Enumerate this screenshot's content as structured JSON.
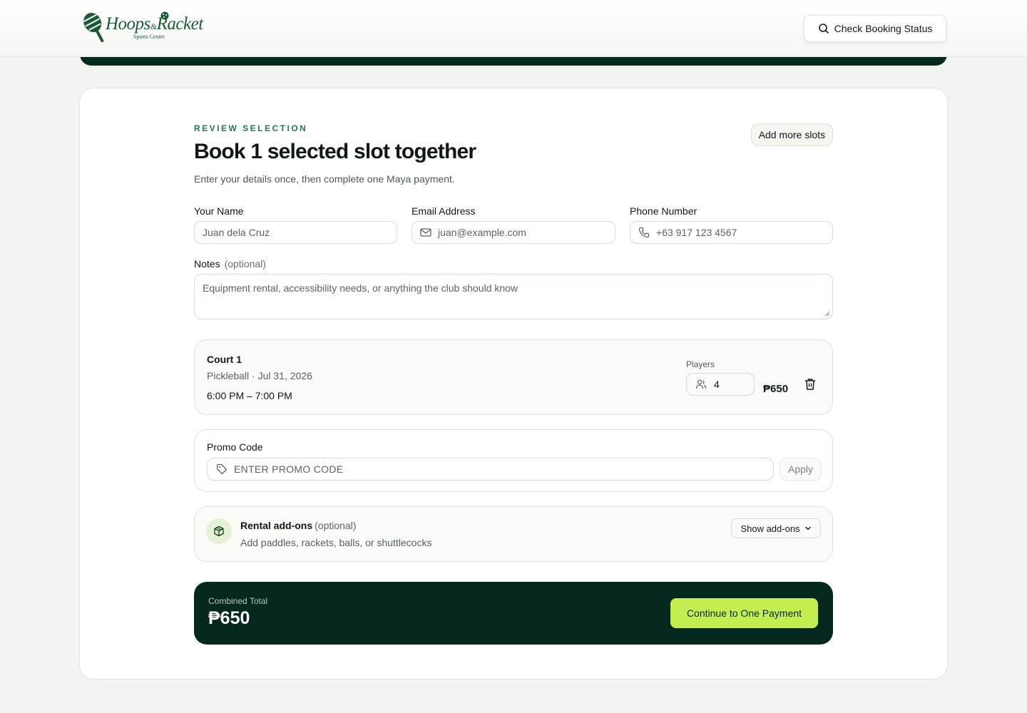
{
  "header": {
    "brand_name": "Hoops",
    "brand_amp": "&",
    "brand_name_2": "Racket",
    "brand_tagline": "Sports Center",
    "status_button": "Check Booking Status"
  },
  "review": {
    "eyebrow": "REVIEW SELECTION",
    "title": "Book 1 selected slot together",
    "subtitle": "Enter your details once, then complete one Maya payment.",
    "add_more_slots": "Add more slots"
  },
  "form": {
    "name_label": "Your Name",
    "name_placeholder": "Juan dela Cruz",
    "email_label": "Email Address",
    "email_placeholder": "juan@example.com",
    "phone_label": "Phone Number",
    "phone_placeholder": "+63 917 123 4567",
    "notes_label": "Notes",
    "notes_optional": "(optional)",
    "notes_placeholder": "Equipment rental, accessibility needs, or anything the club should know"
  },
  "slot": {
    "court": "Court 1",
    "meta": "Pickleball · Jul 31, 2026",
    "time": "6:00 PM – 7:00 PM",
    "players_label": "Players",
    "players": "4",
    "price": "₱650"
  },
  "promo": {
    "label": "Promo Code",
    "placeholder": "ENTER PROMO CODE",
    "apply": "Apply"
  },
  "addons": {
    "title": "Rental add-ons",
    "optional": "(optional)",
    "description": "Add paddles, rackets, balls, or shuttlecocks",
    "toggle": "Show add-ons"
  },
  "total": {
    "label": "Combined Total",
    "value": "₱650",
    "cta": "Continue to One Payment"
  },
  "colors": {
    "brand_dark": "#05291f",
    "accent_lime": "#c4ee4f",
    "eyebrow_green": "#1f7a4f",
    "page_bg": "#f2f4ef"
  },
  "icons": {
    "status": "search-icon",
    "email": "mail-icon",
    "phone": "phone-icon",
    "players": "users-icon",
    "delete": "trash-icon",
    "promo": "tag-icon",
    "addons": "package-icon",
    "toggle": "chevron-down-icon"
  }
}
